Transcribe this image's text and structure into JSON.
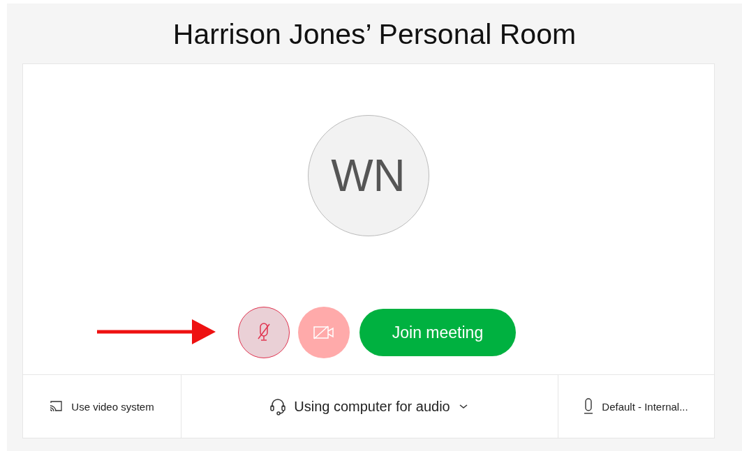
{
  "title": "Harrison Jones’ Personal Room",
  "avatar": {
    "initials": "WN"
  },
  "controls": {
    "mic_muted": true,
    "mic_focused": true,
    "video_muted": true,
    "join_label": "Join meeting"
  },
  "bottom_bar": {
    "video_system": "Use video system",
    "audio": "Using computer for audio",
    "microphone": "Default - Internal..."
  }
}
